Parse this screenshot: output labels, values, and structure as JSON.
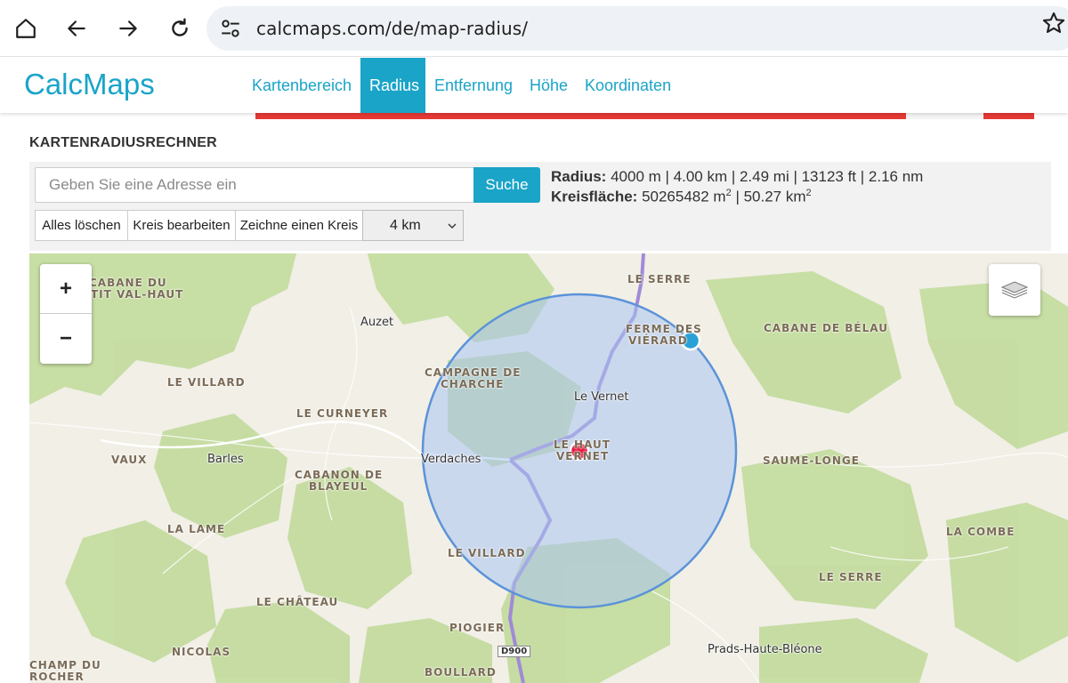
{
  "browser": {
    "url": "calcmaps.com/de/map-radius/"
  },
  "header": {
    "logo": "CalcMaps",
    "nav": [
      {
        "label": "Kartenbereich"
      },
      {
        "label": "Radius"
      },
      {
        "label": "Entfernung"
      },
      {
        "label": "Höhe"
      },
      {
        "label": "Koordinaten"
      }
    ]
  },
  "page": {
    "title": "KARTENRADIUSRECHNER"
  },
  "tool": {
    "address_placeholder": "Geben Sie eine Adresse ein",
    "search_label": "Suche",
    "radius_label": "Radius:",
    "radius_value": "4000 m | 4.00 km | 2.49 mi | 13123 ft | 2.16 nm",
    "area_label": "Kreisfläche:",
    "area_m2": "50265482 m",
    "area_sep": " | 50.27 km",
    "sup2": "2",
    "clear_label": "Alles löschen",
    "edit_label": "Kreis bearbeiten",
    "draw_label": "Zeichne einen Kreis",
    "radius_select_value": "4 km"
  },
  "map": {
    "zoom_in": "+",
    "zoom_out": "−",
    "road_shield": "D900",
    "labels": [
      "CABANE DU",
      "PETIT VAL-HAUT",
      "LE SERRE",
      "FERME DES",
      "VIÉRARD",
      "CABANE DE BÉLAU",
      "CAMPAGNE DE",
      "CHARCHE",
      "LE VILLARD",
      "LE CURNEYER",
      "VAUX",
      "LE HAUT",
      "VERNET",
      "SAUME-LONGE",
      "CABANON DE",
      "BLAYEUL",
      "LA LAME",
      "LE VILLARD",
      "LA COMBE",
      "LE SERRE",
      "LE CHÂTEAU",
      "PIOGIER",
      "NICOLAS",
      "CHAMP DU",
      "ROCHER",
      "BOULLARD"
    ],
    "towns": [
      "Auzet",
      "Le Vernet",
      "Barles",
      "Verdaches",
      "Prads-Haute-Bléone"
    ]
  },
  "colors": {
    "accent": "#1aa4c8",
    "ad_red": "#e53935",
    "circle_fill": "#a9c4f2",
    "circle_stroke": "#5b93d8",
    "center_marker": "#e8143c",
    "edge_marker": "#2aa1d6",
    "forest": "#bfd99a",
    "route": "#a08ad6"
  }
}
